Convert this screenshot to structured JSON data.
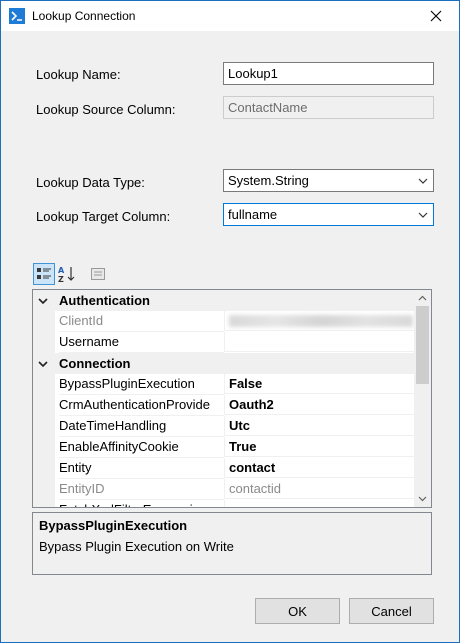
{
  "window": {
    "title": "Lookup Connection",
    "icon": "app-logo-icon",
    "close_icon": "close-icon"
  },
  "form": {
    "lookup_name_label": "Lookup Name:",
    "lookup_name_value": "Lookup1",
    "lookup_source_column_label": "Lookup Source Column:",
    "lookup_source_column_value": "ContactName",
    "lookup_data_type_label": "Lookup Data Type:",
    "lookup_data_type_value": "System.String",
    "lookup_target_column_label": "Lookup Target Column:",
    "lookup_target_column_value": "fullname"
  },
  "toolbar": {
    "categorized_icon": "categorized-icon",
    "alphabetical_icon": "sort-az-icon",
    "property_pages_icon": "property-pages-icon"
  },
  "grid": {
    "rows": [
      {
        "type": "category",
        "name": "Authentication",
        "expanded": true
      },
      {
        "type": "property",
        "name": "ClientId",
        "value": "",
        "readonly": true,
        "blurred": true
      },
      {
        "type": "property",
        "name": "Username",
        "value": ""
      },
      {
        "type": "category",
        "name": "Connection",
        "expanded": true
      },
      {
        "type": "property",
        "name": "BypassPluginExecution",
        "value": "False",
        "bold": true
      },
      {
        "type": "property",
        "name": "CrmAuthenticationProvide",
        "value": "Oauth2",
        "bold": true
      },
      {
        "type": "property",
        "name": "DateTimeHandling",
        "value": "Utc",
        "bold": true
      },
      {
        "type": "property",
        "name": "EnableAffinityCookie",
        "value": "True",
        "bold": true
      },
      {
        "type": "property",
        "name": "Entity",
        "value": "contact",
        "bold": true
      },
      {
        "type": "property",
        "name": "EntityID",
        "value": "contactid",
        "readonly": true
      },
      {
        "type": "property",
        "name": "FetchXmlFilterExpression",
        "value": ""
      }
    ]
  },
  "description": {
    "title": "BypassPluginExecution",
    "text": "Bypass Plugin Execution on Write"
  },
  "buttons": {
    "ok": "OK",
    "cancel": "Cancel"
  }
}
